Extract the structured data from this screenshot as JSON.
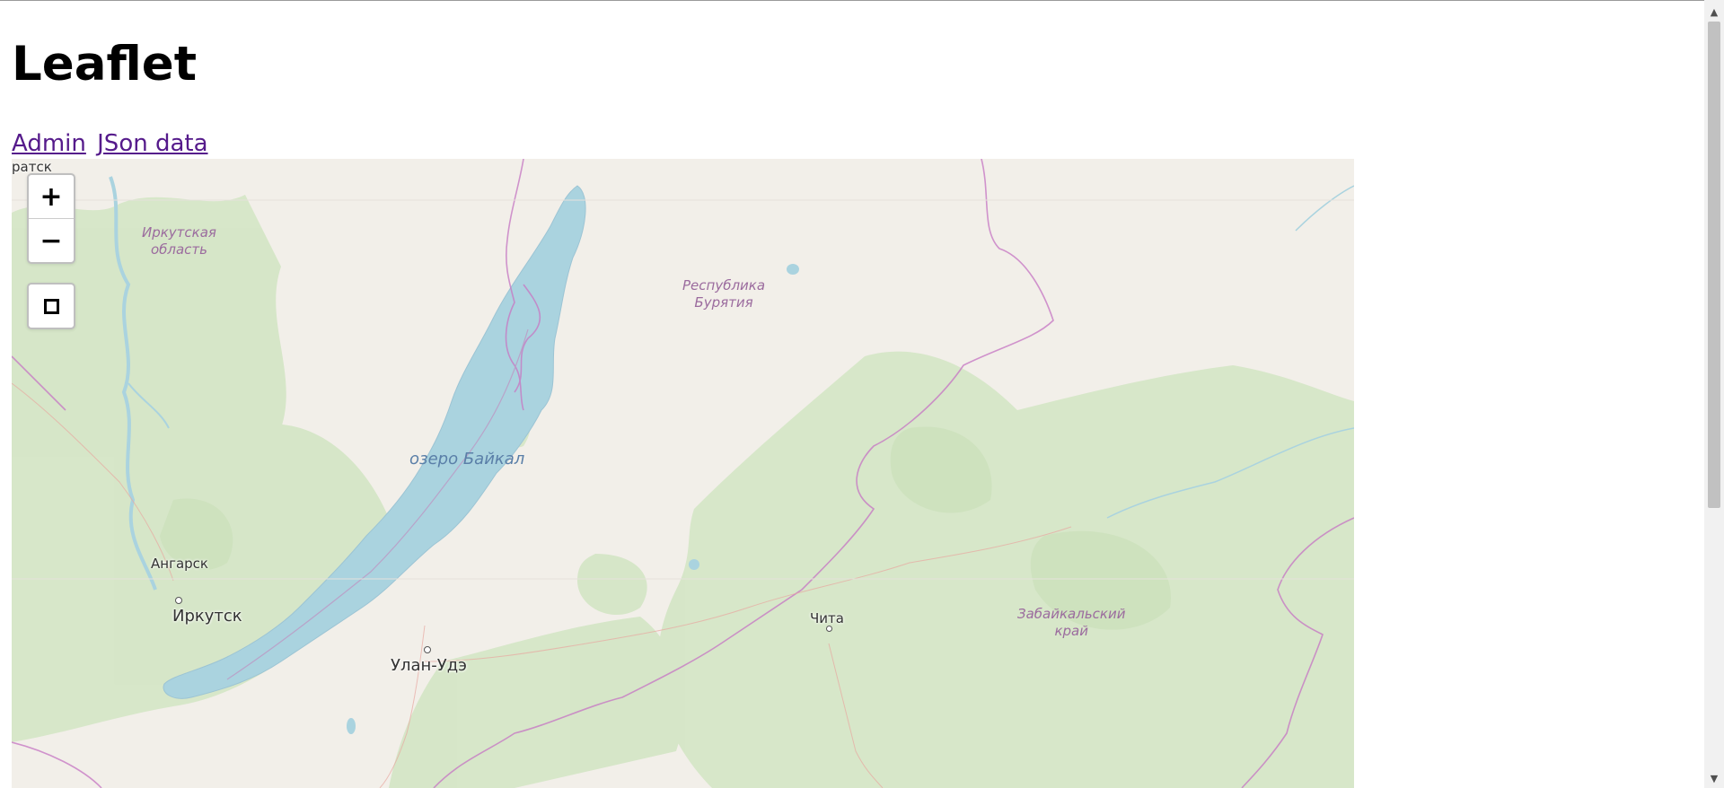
{
  "page": {
    "heading": "Leaflet"
  },
  "nav": {
    "admin_link": "Admin",
    "json_link": "JSon data"
  },
  "map": {
    "zoom_in": "+",
    "zoom_out": "−",
    "labels": {
      "partial_city": "ратск",
      "irkutsk_oblast": "Иркутская\nобласть",
      "buryatia": "Республика\nБурятия",
      "baikal": "озеро Байкал",
      "angarsk": "Ангарск",
      "irkutsk": "Иркутск",
      "ulan_ude": "Улан-Удэ",
      "chita": "Чита",
      "zabaikalsky": "Забайкальский\nкрай"
    },
    "colors": {
      "land": "#f2efe9",
      "forest": "#d5e6c7",
      "water": "#aad3df",
      "border": "#c77bc4"
    }
  },
  "scrollbar": {
    "up": "▲",
    "down": "▼"
  }
}
